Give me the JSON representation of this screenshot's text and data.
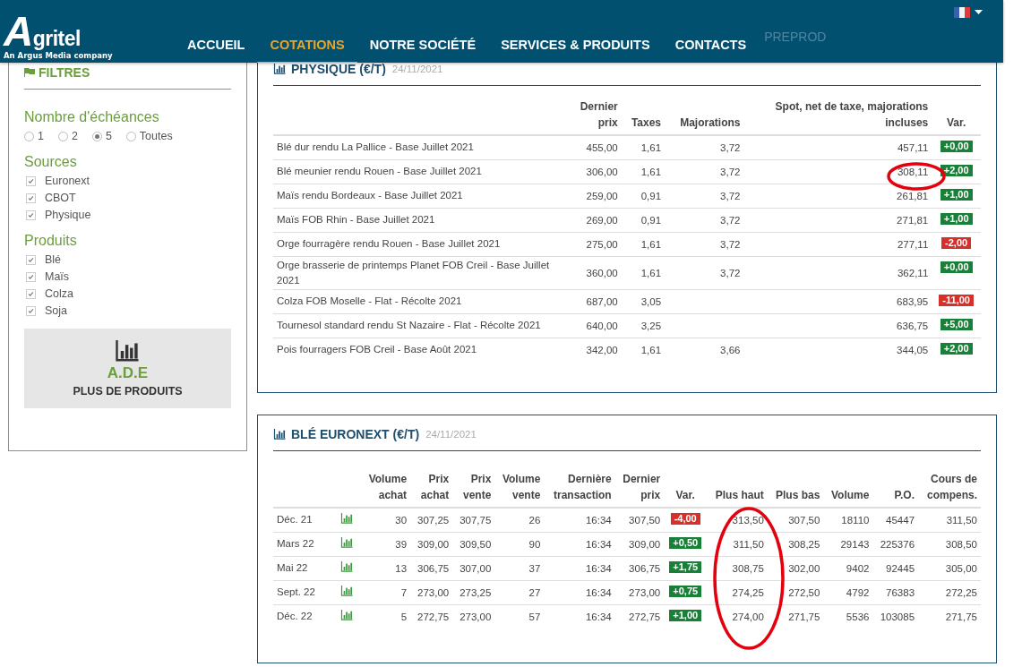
{
  "header": {
    "logo": {
      "name": "Agritel",
      "tagline": "An Argus Media company"
    },
    "nav": [
      {
        "label": "ACCUEIL",
        "selected": false
      },
      {
        "label": "COTATIONS",
        "selected": true
      },
      {
        "label": "NOTRE SOCIÉTÉ",
        "selected": false
      },
      {
        "label": "SERVICES & PRODUITS",
        "selected": false
      },
      {
        "label": "CONTACTS",
        "selected": false
      }
    ],
    "environment": "PREPROD"
  },
  "filters": {
    "title": "FILTRES",
    "groups": [
      {
        "title": "Nombre d'échéances",
        "kind": "radio",
        "options": [
          {
            "label": "1",
            "selected": false
          },
          {
            "label": "2",
            "selected": false
          },
          {
            "label": "5",
            "selected": true
          },
          {
            "label": "Toutes",
            "selected": false
          }
        ]
      },
      {
        "title": "Sources",
        "kind": "checkbox",
        "options": [
          {
            "label": "Euronext",
            "checked": true
          },
          {
            "label": "CBOT",
            "checked": true
          },
          {
            "label": "Physique",
            "checked": true
          }
        ]
      },
      {
        "title": "Produits",
        "kind": "checkbox",
        "options": [
          {
            "label": "Blé",
            "checked": true
          },
          {
            "label": "Maïs",
            "checked": true
          },
          {
            "label": "Colza",
            "checked": true
          },
          {
            "label": "Soja",
            "checked": true
          }
        ]
      }
    ],
    "promo": {
      "title": "A.D.E",
      "subtitle": "PLUS DE PRODUITS"
    }
  },
  "tables": [
    {
      "title": "PHYSIQUE (€/T)",
      "date": "24/11/2021",
      "columns": [
        null,
        "Dernier\nprix",
        "Taxes",
        "Majorations",
        "Spot, net de taxe, majorations\nincluses",
        "Var."
      ],
      "rows": [
        {
          "cells": [
            "Blé dur rendu La Pallice - Base Juillet 2021",
            "455,00",
            "1,61",
            "3,72",
            "457,11",
            {
              "kind": "badge",
              "value": "+0,00",
              "negative": false
            }
          ]
        },
        {
          "cells": [
            "Blé meunier rendu Rouen - Base Juillet 2021",
            "306,00",
            "1,61",
            "3,72",
            "308,11",
            {
              "kind": "badge",
              "value": "+2,00",
              "negative": false
            }
          ]
        },
        {
          "cells": [
            "Maïs rendu Bordeaux - Base Juillet 2021",
            "259,00",
            "0,91",
            "3,72",
            "261,81",
            {
              "kind": "badge",
              "value": "+1,00",
              "negative": false
            }
          ]
        },
        {
          "cells": [
            "Maïs FOB Rhin - Base Juillet 2021",
            "269,00",
            "0,91",
            "3,72",
            "271,81",
            {
              "kind": "badge",
              "value": "+1,00",
              "negative": false
            }
          ]
        },
        {
          "cells": [
            "Orge fourragère rendu Rouen - Base Juillet 2021",
            "275,00",
            "1,61",
            "3,72",
            "277,11",
            {
              "kind": "badge",
              "value": "-2,00",
              "negative": true
            }
          ]
        },
        {
          "cells": [
            "Orge brasserie de printemps Planet FOB Creil - Base Juillet 2021",
            "360,00",
            "1,61",
            "3,72",
            "362,11",
            {
              "kind": "badge",
              "value": "+0,00",
              "negative": false
            }
          ]
        },
        {
          "cells": [
            "Colza FOB Moselle - Flat - Récolte 2021",
            "687,00",
            "3,05",
            "",
            "683,95",
            {
              "kind": "badge",
              "value": "-11,00",
              "negative": true
            }
          ]
        },
        {
          "cells": [
            "Tournesol standard rendu St Nazaire - Flat - Récolte 2021",
            "640,00",
            "3,25",
            "",
            "636,75",
            {
              "kind": "badge",
              "value": "+5,00",
              "negative": false
            }
          ]
        },
        {
          "cells": [
            "Pois fourragers FOB Creil - Base Août 2021",
            "342,00",
            "1,61",
            "3,66",
            "344,05",
            {
              "kind": "badge",
              "value": "+2,00",
              "negative": false
            }
          ]
        }
      ]
    },
    {
      "title": "BLÉ EURONEXT (€/T)",
      "date": "24/11/2021",
      "columns": [
        null,
        null,
        "Volume\nachat",
        "Prix\nachat",
        "Prix\nvente",
        "Volume\nvente",
        "Dernière\ntransaction",
        "Dernier\nprix",
        "Var.",
        "Plus haut",
        "Plus bas",
        "Volume",
        "P.O.",
        "Cours de\ncompens."
      ],
      "rows": [
        {
          "cells": [
            "Déc. 21",
            {
              "kind": "icon"
            },
            "30",
            "307,25",
            "307,75",
            "26",
            "16:34",
            "307,50",
            {
              "kind": "badge",
              "value": "-4,00",
              "negative": true
            },
            "313,50",
            "307,50",
            "18110",
            "45447",
            "311,50"
          ]
        },
        {
          "cells": [
            "Mars 22",
            {
              "kind": "icon"
            },
            "39",
            "309,00",
            "309,50",
            "90",
            "16:34",
            "309,00",
            {
              "kind": "badge",
              "value": "+0,50",
              "negative": false
            },
            "311,50",
            "308,25",
            "29143",
            "225376",
            "308,50"
          ]
        },
        {
          "cells": [
            "Mai 22",
            {
              "kind": "icon"
            },
            "13",
            "306,75",
            "307,00",
            "37",
            "16:34",
            "306,75",
            {
              "kind": "badge",
              "value": "+1,75",
              "negative": false
            },
            "308,75",
            "302,00",
            "9402",
            "92445",
            "305,00"
          ]
        },
        {
          "cells": [
            "Sept. 22",
            {
              "kind": "icon"
            },
            "7",
            "273,00",
            "273,25",
            "27",
            "16:34",
            "273,00",
            {
              "kind": "badge",
              "value": "+0,75",
              "negative": false
            },
            "274,25",
            "272,50",
            "4792",
            "76383",
            "272,25"
          ]
        },
        {
          "cells": [
            "Déc. 22",
            {
              "kind": "icon"
            },
            "5",
            "272,75",
            "273,00",
            "57",
            "16:34",
            "272,75",
            {
              "kind": "badge",
              "value": "+1,00",
              "negative": false
            },
            "274,00",
            "271,75",
            "5536",
            "103085",
            "271,75"
          ]
        }
      ]
    }
  ]
}
